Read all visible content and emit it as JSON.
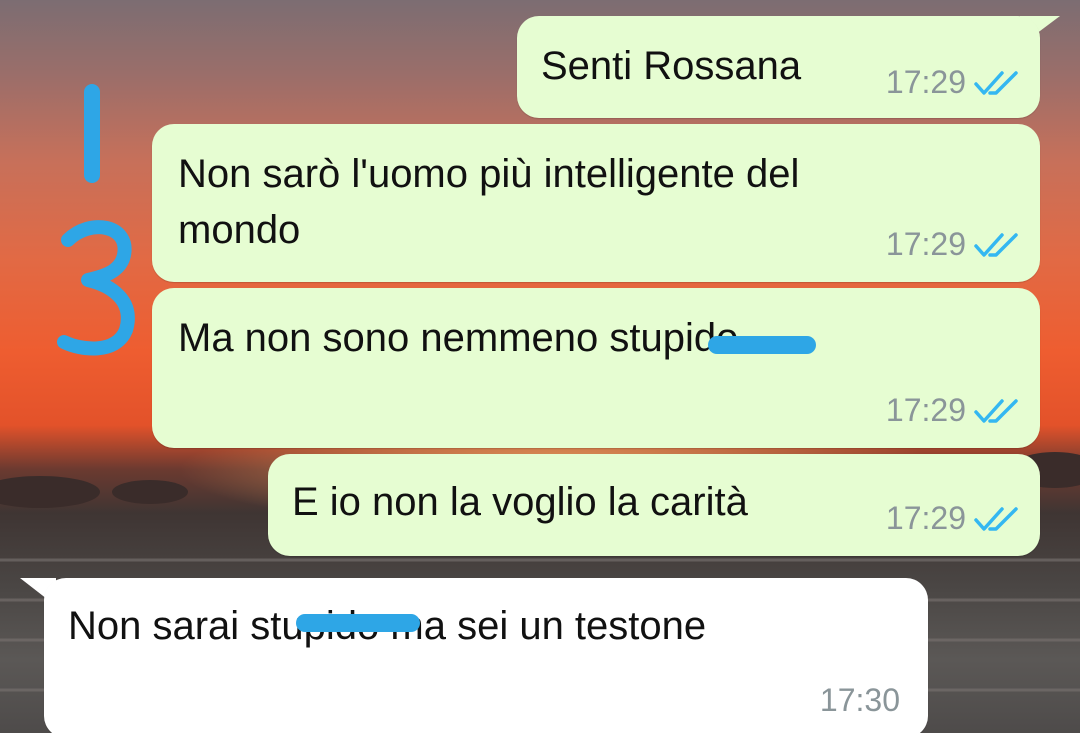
{
  "colors": {
    "outgoing_bubble": "#e6fdd2",
    "incoming_bubble": "#ffffff",
    "read_ticks": "#34b7f1",
    "timestamp": "#8a9599",
    "annotation": "#2ea6e6"
  },
  "messages": [
    {
      "text": "Senti Rossana",
      "time": "17:29",
      "status": "read",
      "direction": "outgoing"
    },
    {
      "line1": "Non sarò l'uomo più intelligente del",
      "line2": "mondo",
      "time": "17:29",
      "status": "read",
      "direction": "outgoing"
    },
    {
      "text": "Ma non sono nemmeno stupido",
      "time": "17:29",
      "status": "read",
      "direction": "outgoing"
    },
    {
      "text": "E io non la voglio la carità",
      "time": "17:29",
      "status": "read",
      "direction": "outgoing"
    },
    {
      "text": "Non sarai stupido ma sei un testone",
      "time": "17:30",
      "direction": "incoming"
    }
  ],
  "annotation": {
    "icon": "handwritten-1-3-marker",
    "text": "13"
  }
}
